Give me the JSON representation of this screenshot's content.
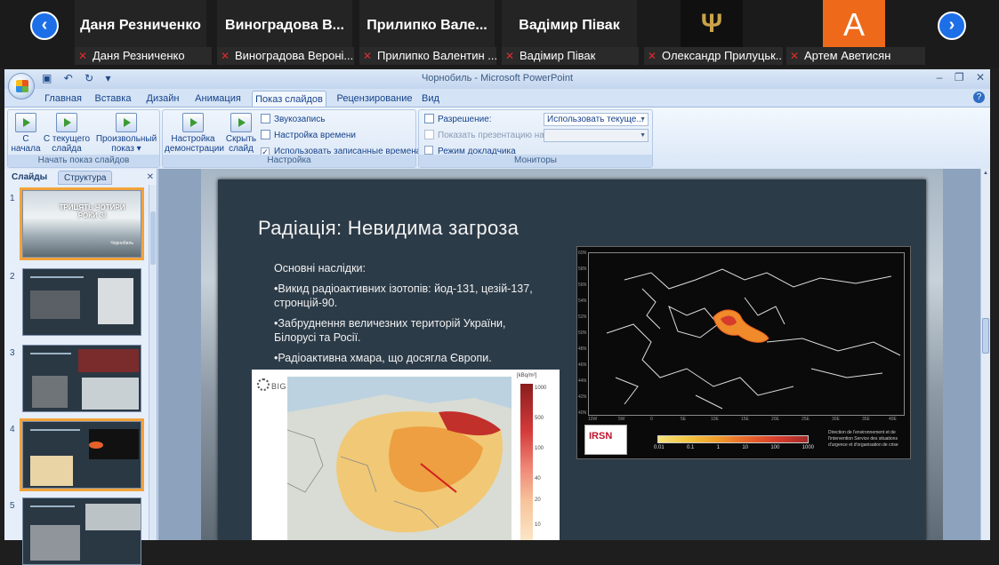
{
  "meeting": {
    "tiles": [
      "Даня Резниченко",
      "Виноградова  В...",
      "Прилипко  Вале...",
      "Вадімир Півак"
    ],
    "avatar_letter": "A",
    "tags": [
      "Даня Резниченко",
      "Виноградова Вероні...",
      "Прилипко Валентин ...",
      "Вадімир Півак",
      "Олександр Прилуцьк...",
      "Артем Аветисян"
    ],
    "mic_icon": "mic-off-icon",
    "nav_color": "#1d6fe8",
    "avatar_color": "#ee6a1a"
  },
  "window": {
    "title": "Чорнобиль - Microsoft PowerPoint"
  },
  "tabs": [
    "Главная",
    "Вставка",
    "Дизайн",
    "Анимация",
    "Показ слайдов",
    "Рецензирование",
    "Вид"
  ],
  "active_tab": "Показ слайдов",
  "ribbon": {
    "group_start": {
      "label": "Начать показ слайдов",
      "btn_from_start": [
        "С",
        "начала"
      ],
      "btn_from_current": [
        "С текущего",
        "слайда"
      ],
      "btn_custom": [
        "Произвольный",
        "показ ▾"
      ]
    },
    "group_setup": {
      "label": "Настройка",
      "btn_setup": [
        "Настройка",
        "демонстрации"
      ],
      "btn_hide": [
        "Скрыть",
        "слайд"
      ],
      "record": "Звукозапись",
      "rehearse": "Настройка времени",
      "use_timings": "Использовать записанные времена"
    },
    "group_monitors": {
      "label": "Мониторы",
      "resolution_label": "Разрешение:",
      "resolution_value": "Использовать текуще...",
      "show_on_label": "Показать презентацию на:",
      "presenter_view": "Режим докладчика"
    }
  },
  "panel": {
    "tab_slides": "Слайды",
    "tab_outline": "Структура",
    "thumbs": [
      {
        "num": "1",
        "title": "ТРИЦЯТЬ ЧОТИРИ РОКИ ЗІ",
        "sub": "Чорнобиль"
      },
      {
        "num": "2"
      },
      {
        "num": "3"
      },
      {
        "num": "4"
      },
      {
        "num": "5"
      }
    ]
  },
  "slide": {
    "title": "Радіація: Невидима загроза",
    "intro": "Основні наслідки:",
    "bullets": [
      "•Викид радіоактивних ізотопів: йод-131, цезій-137, стронцій-90.",
      "•Забруднення величезних територій України, Білорусі та Росії.",
      "•Радіоактивна хмара, що досягла Європи."
    ],
    "map_dark": {
      "lat_ticks": [
        "60N",
        "58N",
        "56N",
        "54N",
        "52N",
        "50N",
        "48N",
        "46N",
        "44N",
        "42N",
        "40N"
      ],
      "lon_ticks": [
        "10W",
        "5W",
        "0",
        "5E",
        "10E",
        "15E",
        "20E",
        "25E",
        "30E",
        "35E",
        "40E"
      ],
      "legend": [
        "0.01",
        "0.1",
        "1",
        "10",
        "100",
        "1000"
      ],
      "logo": "IRSN",
      "note": "Direction de l'environnement et de l'intervention Service des situations d'urgence et d'organisation de crise"
    },
    "map_light": {
      "brand": "BIG KYIV",
      "unit": "[kBq/m²]",
      "ticks": [
        "1000",
        "500",
        "100",
        "40",
        "20",
        "10"
      ]
    }
  }
}
